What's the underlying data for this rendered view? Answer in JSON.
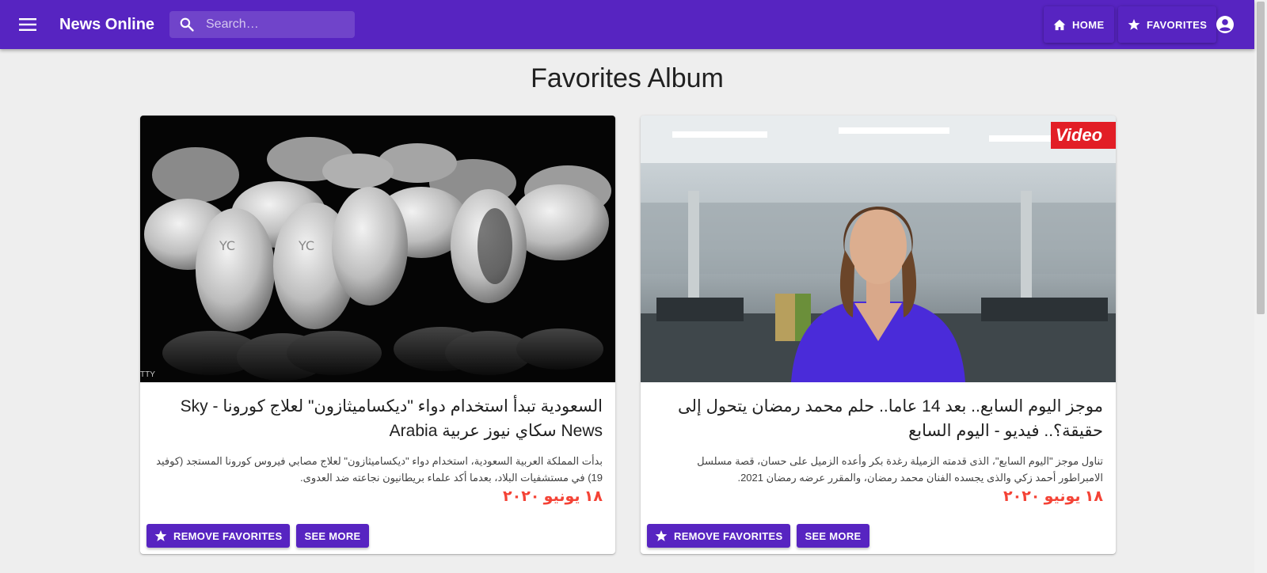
{
  "appbar": {
    "title": "News Online",
    "search_placeholder": "Search…",
    "home_label": "HOME",
    "favorites_label": "FAVORITES",
    "icons": {
      "menu": "menu-icon",
      "search": "search-icon",
      "home": "home-icon",
      "favorites": "star-icon",
      "account": "account-circle-icon"
    },
    "color": "#5724c1"
  },
  "page": {
    "title": "Favorites Album"
  },
  "cards": [
    {
      "title": "السعودية تبدأ استخدام دواء \"ديكساميثازون\" لعلاج كورونا - Sky News سكاي نيوز عربية Arabia",
      "text": "بدأت المملكة العربية السعودية، استخدام دواء \"ديكساميثازون\" لعلاج مصابي فيروس كورونا المستجد (كوفيد 19) في مستشفيات البلاد، بعدما أكد علماء بريطانيون نجاعته ضد العدوى.",
      "date": "١٨ يونيو ٢٠٢٠",
      "image_caption": "TTY",
      "remove_label": "REMOVE FAVORITES",
      "see_more_label": "SEE MORE"
    },
    {
      "title": "موجز اليوم السابع.. بعد 14 عاما.. حلم محمد رمضان يتحول إلى حقيقة؟.. فيديو - اليوم السابع",
      "text": "تناول موجز \"اليوم السابع\"، الذى قدمته الزميلة رغدة بكر وأعده الزميل على حسان، قصة مسلسل الامبراطور أحمد زكي والذى يجسده الفنان محمد رمضان، والمقرر عرضه رمضان 2021.",
      "date": "١٨ يونيو ٢٠٢٠",
      "image_badge": "Video",
      "remove_label": "REMOVE FAVORITES",
      "see_more_label": "SEE MORE"
    }
  ],
  "colors": {
    "primary": "#5724c1",
    "date": "#f44336",
    "background": "#eeeeee"
  }
}
